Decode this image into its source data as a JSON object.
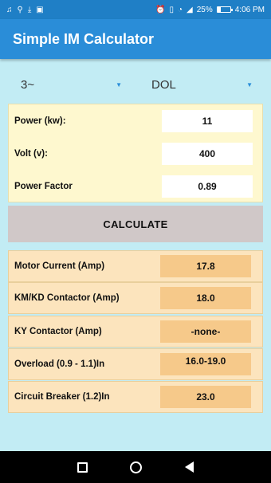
{
  "status_bar": {
    "left_icons": [
      "music-note-icon",
      "usb-icon",
      "download-icon",
      "gallery-icon"
    ],
    "battery_percent": "25%",
    "battery_level": 0.25,
    "time": "4:06 PM"
  },
  "app": {
    "title": "Simple IM Calculator"
  },
  "selectors": {
    "phase": "3~",
    "starter": "DOL"
  },
  "inputs": {
    "power": {
      "label": "Power (kw):",
      "value": "11"
    },
    "volt": {
      "label": "Volt (v):",
      "value": "400"
    },
    "power_factor": {
      "label": "Power Factor",
      "value": "0.89"
    }
  },
  "calculate_label": "CALCULATE",
  "results": {
    "motor_current": {
      "label": "Motor Current (Amp)",
      "value": "17.8"
    },
    "km_kd": {
      "label": "KM/KD Contactor (Amp)",
      "value": "18.0"
    },
    "ky": {
      "label": "KY Contactor (Amp)",
      "value": "-none-"
    },
    "overload": {
      "label": "Overload (0.9 - 1.1)In",
      "value": "16.0-19.0"
    },
    "breaker": {
      "label": "Circuit Breaker (1.2)In",
      "value": "23.0"
    }
  }
}
